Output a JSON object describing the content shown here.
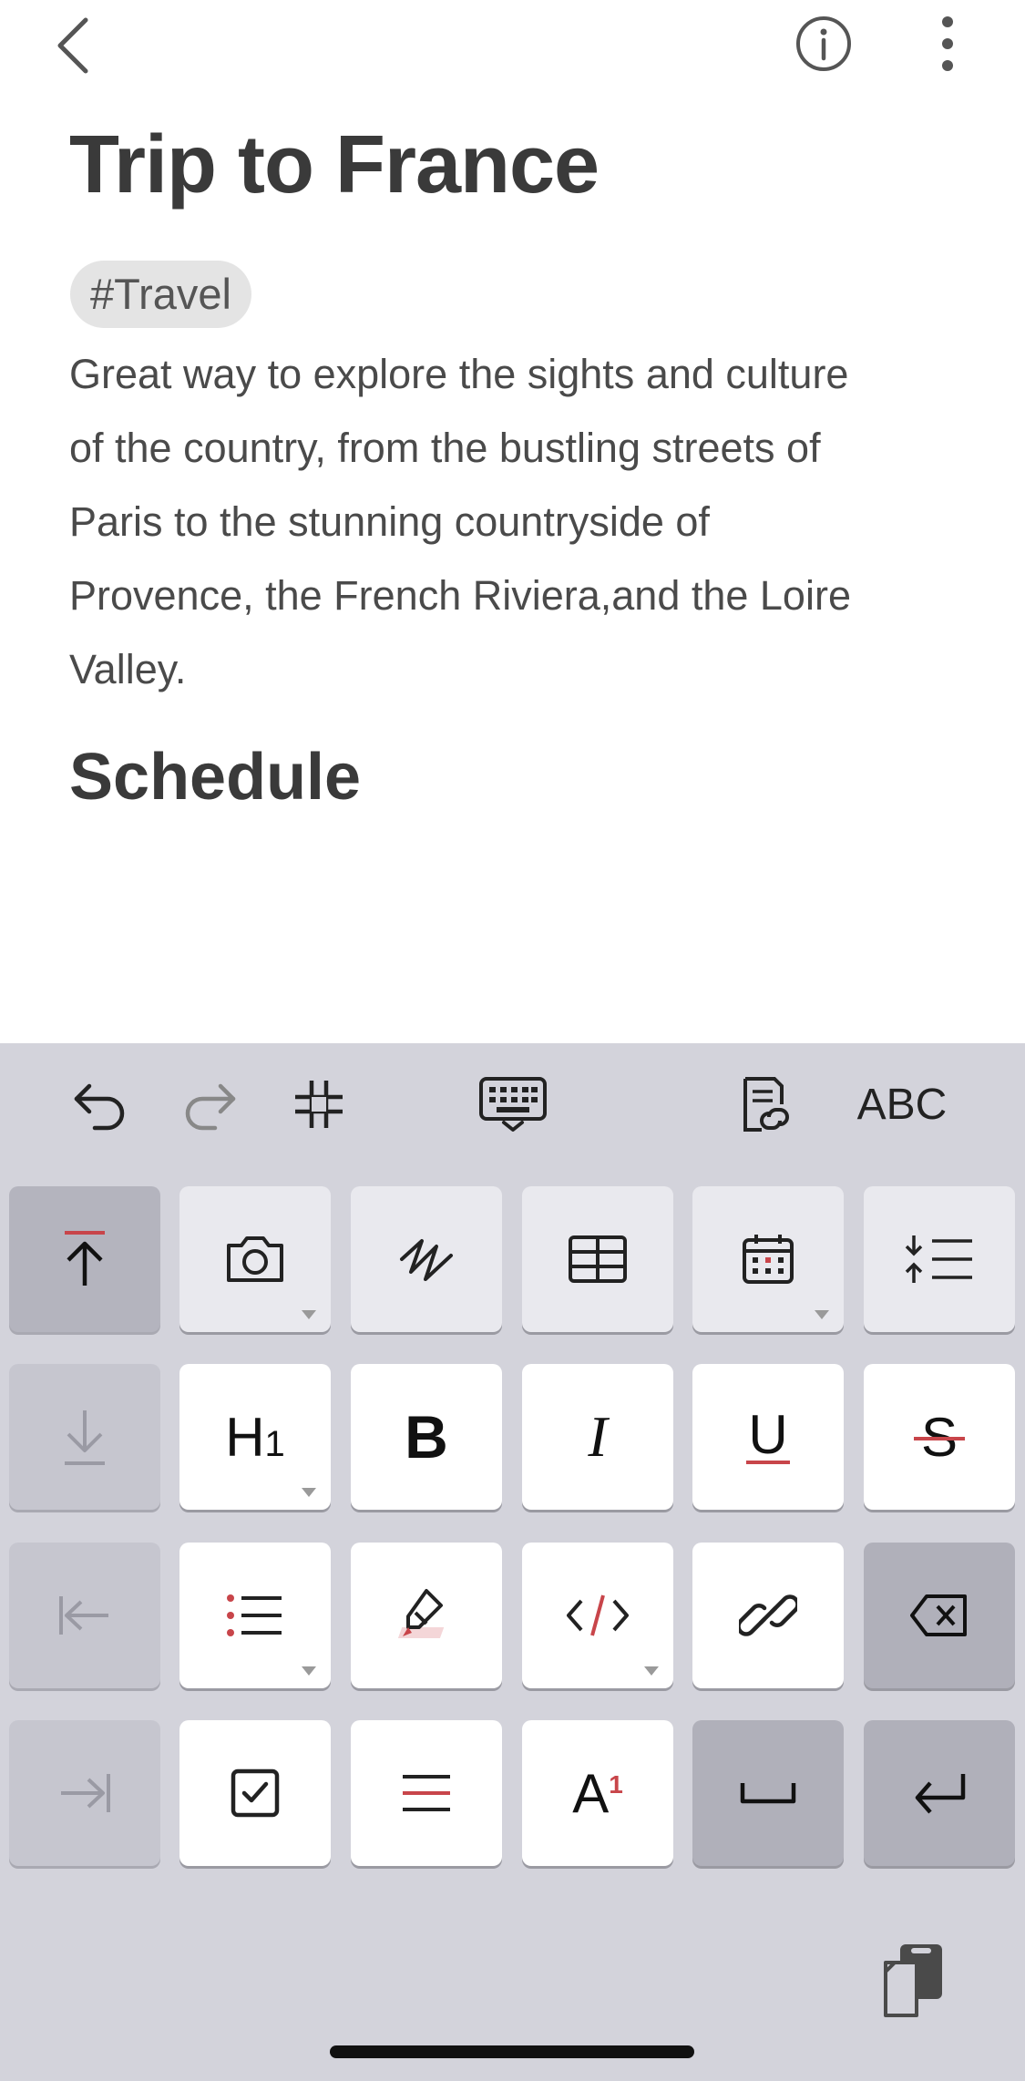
{
  "note": {
    "title": "Trip to France",
    "tag": "#Travel",
    "body_lines": [
      "Great way to explore the sights and culture",
      "of the country, from the bustling streets of",
      "Paris to the stunning countryside of",
      "Provence, the French Riviera,and the Loire",
      "Valley."
    ],
    "heading": "Schedule"
  },
  "toolbar": {
    "abc_label": "ABC",
    "icons": [
      "undo-icon",
      "redo-icon",
      "format-icon",
      "keyboard-icon",
      "note-link-icon"
    ]
  },
  "keys": {
    "h1_label": "H",
    "h1_sub": "1",
    "bold_label": "B",
    "italic_label": "I",
    "underline_label": "U",
    "strike_label": "S",
    "superscript_label": "A",
    "superscript_sub": "1"
  },
  "colors": {
    "accent": "#c8454a",
    "keyboard_bg": "#d3d3db",
    "key_bg": "#ffffff",
    "key_dark": "#b0b0ba"
  }
}
